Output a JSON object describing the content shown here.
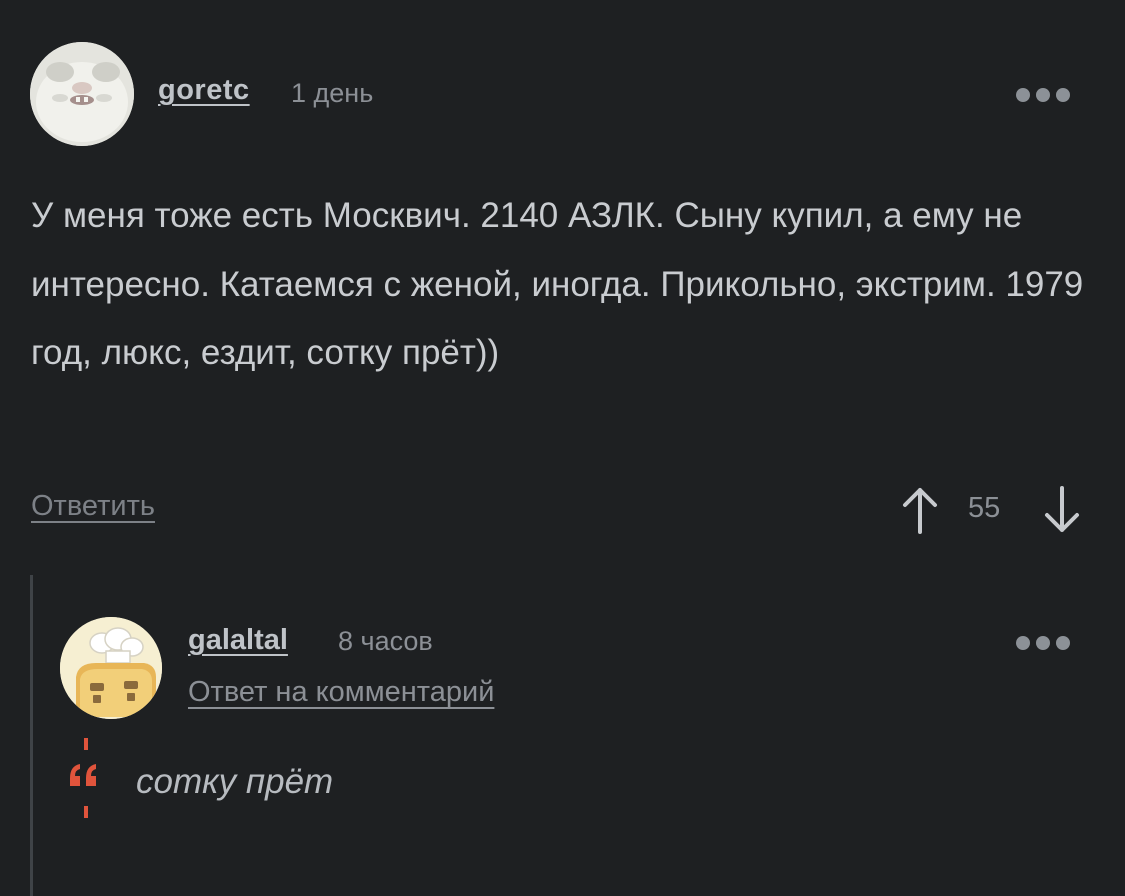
{
  "comment": {
    "author": "goretc",
    "time": "1 день",
    "body": "У меня тоже есть Москвич. 2140 АЗЛК. Сыну купил, а ему не интересно. Катаемся с женой, иногда. Прикольно, экстрим. 1979 год, люкс, ездит, сотку прёт))",
    "reply_label": "Ответить",
    "rating": "55",
    "icons": {
      "more": "more-dots-icon",
      "upvote": "arrow-up-icon",
      "downvote": "arrow-down-icon"
    }
  },
  "reply": {
    "author": "galaltal",
    "time": "8 часов",
    "reply_to_label": "Ответ на комментарий",
    "quote": "сотку прёт",
    "icons": {
      "more": "more-dots-icon",
      "quote": "quote-icon"
    }
  },
  "colors": {
    "background": "#1e2022",
    "quote_accent": "#e0543c",
    "thread_line": "#3f4347"
  }
}
